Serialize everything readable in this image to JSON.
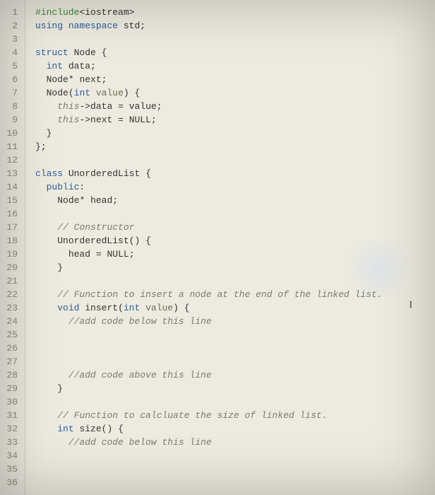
{
  "cursor_glyph": "I",
  "line_numbers": [
    "1",
    "2",
    "3",
    "4",
    "5",
    "6",
    "7",
    "8",
    "9",
    "10",
    "11",
    "12",
    "13",
    "14",
    "15",
    "16",
    "17",
    "18",
    "19",
    "20",
    "21",
    "22",
    "23",
    "24",
    "25",
    "26",
    "27",
    "28",
    "29",
    "30",
    "31",
    "32",
    "33",
    "34",
    "35",
    "36"
  ],
  "lines": [
    {
      "tokens": [
        {
          "cls": "tok-pp",
          "t": "#include"
        },
        {
          "cls": "tok-op",
          "t": "<"
        },
        {
          "cls": "tok-ident",
          "t": "iostream"
        },
        {
          "cls": "tok-op",
          "t": ">"
        }
      ]
    },
    {
      "tokens": [
        {
          "cls": "tok-kw",
          "t": "using"
        },
        {
          "cls": "",
          "t": " "
        },
        {
          "cls": "tok-kw",
          "t": "namespace"
        },
        {
          "cls": "",
          "t": " "
        },
        {
          "cls": "tok-ident",
          "t": "std"
        },
        {
          "cls": "tok-op",
          "t": ";"
        }
      ]
    },
    {
      "tokens": []
    },
    {
      "tokens": [
        {
          "cls": "tok-kw",
          "t": "struct"
        },
        {
          "cls": "",
          "t": " "
        },
        {
          "cls": "tok-ident",
          "t": "Node"
        },
        {
          "cls": "",
          "t": " "
        },
        {
          "cls": "tok-op",
          "t": "{"
        }
      ]
    },
    {
      "tokens": [
        {
          "cls": "",
          "t": "  "
        },
        {
          "cls": "tok-type",
          "t": "int"
        },
        {
          "cls": "",
          "t": " "
        },
        {
          "cls": "tok-ident",
          "t": "data"
        },
        {
          "cls": "tok-op",
          "t": ";"
        }
      ]
    },
    {
      "tokens": [
        {
          "cls": "",
          "t": "  "
        },
        {
          "cls": "tok-ident",
          "t": "Node"
        },
        {
          "cls": "tok-op",
          "t": "*"
        },
        {
          "cls": "",
          "t": " "
        },
        {
          "cls": "tok-ident",
          "t": "next"
        },
        {
          "cls": "tok-op",
          "t": ";"
        }
      ]
    },
    {
      "tokens": [
        {
          "cls": "",
          "t": "  "
        },
        {
          "cls": "tok-ident",
          "t": "Node"
        },
        {
          "cls": "tok-op",
          "t": "("
        },
        {
          "cls": "tok-type",
          "t": "int"
        },
        {
          "cls": "",
          "t": " "
        },
        {
          "cls": "tok-param",
          "t": "value"
        },
        {
          "cls": "tok-op",
          "t": ")"
        },
        {
          "cls": "",
          "t": " "
        },
        {
          "cls": "tok-op",
          "t": "{"
        }
      ]
    },
    {
      "tokens": [
        {
          "cls": "",
          "t": "    "
        },
        {
          "cls": "tok-this",
          "t": "this"
        },
        {
          "cls": "tok-op",
          "t": "->"
        },
        {
          "cls": "tok-ident",
          "t": "data"
        },
        {
          "cls": "",
          "t": " "
        },
        {
          "cls": "tok-op",
          "t": "="
        },
        {
          "cls": "",
          "t": " "
        },
        {
          "cls": "tok-ident",
          "t": "value"
        },
        {
          "cls": "tok-op",
          "t": ";"
        }
      ]
    },
    {
      "tokens": [
        {
          "cls": "",
          "t": "    "
        },
        {
          "cls": "tok-this",
          "t": "this"
        },
        {
          "cls": "tok-op",
          "t": "->"
        },
        {
          "cls": "tok-ident",
          "t": "next"
        },
        {
          "cls": "",
          "t": " "
        },
        {
          "cls": "tok-op",
          "t": "="
        },
        {
          "cls": "",
          "t": " "
        },
        {
          "cls": "tok-ident",
          "t": "NULL"
        },
        {
          "cls": "tok-op",
          "t": ";"
        }
      ]
    },
    {
      "tokens": [
        {
          "cls": "",
          "t": "  "
        },
        {
          "cls": "tok-op",
          "t": "}"
        }
      ]
    },
    {
      "tokens": [
        {
          "cls": "tok-op",
          "t": "};"
        }
      ]
    },
    {
      "tokens": []
    },
    {
      "tokens": [
        {
          "cls": "tok-kw",
          "t": "class"
        },
        {
          "cls": "",
          "t": " "
        },
        {
          "cls": "tok-ident",
          "t": "UnorderedList"
        },
        {
          "cls": "",
          "t": " "
        },
        {
          "cls": "tok-op",
          "t": "{"
        }
      ]
    },
    {
      "tokens": [
        {
          "cls": "",
          "t": "  "
        },
        {
          "cls": "tok-kw",
          "t": "public"
        },
        {
          "cls": "tok-op",
          "t": ":"
        }
      ]
    },
    {
      "tokens": [
        {
          "cls": "",
          "t": "    "
        },
        {
          "cls": "tok-ident",
          "t": "Node"
        },
        {
          "cls": "tok-op",
          "t": "*"
        },
        {
          "cls": "",
          "t": " "
        },
        {
          "cls": "tok-ident",
          "t": "head"
        },
        {
          "cls": "tok-op",
          "t": ";"
        }
      ]
    },
    {
      "tokens": []
    },
    {
      "tokens": [
        {
          "cls": "",
          "t": "    "
        },
        {
          "cls": "tok-comment",
          "t": "// Constructor"
        }
      ]
    },
    {
      "tokens": [
        {
          "cls": "",
          "t": "    "
        },
        {
          "cls": "tok-ident",
          "t": "UnorderedList"
        },
        {
          "cls": "tok-op",
          "t": "()"
        },
        {
          "cls": "",
          "t": " "
        },
        {
          "cls": "tok-op",
          "t": "{"
        }
      ]
    },
    {
      "tokens": [
        {
          "cls": "",
          "t": "      "
        },
        {
          "cls": "tok-ident",
          "t": "head"
        },
        {
          "cls": "",
          "t": " "
        },
        {
          "cls": "tok-op",
          "t": "="
        },
        {
          "cls": "",
          "t": " "
        },
        {
          "cls": "tok-ident",
          "t": "NULL"
        },
        {
          "cls": "tok-op",
          "t": ";"
        }
      ]
    },
    {
      "tokens": [
        {
          "cls": "",
          "t": "    "
        },
        {
          "cls": "tok-op",
          "t": "}"
        }
      ]
    },
    {
      "tokens": []
    },
    {
      "tokens": [
        {
          "cls": "",
          "t": "    "
        },
        {
          "cls": "tok-comment",
          "t": "// Function to insert a node at the end of the linked list."
        }
      ]
    },
    {
      "tokens": [
        {
          "cls": "",
          "t": "    "
        },
        {
          "cls": "tok-type",
          "t": "void"
        },
        {
          "cls": "",
          "t": " "
        },
        {
          "cls": "tok-ident",
          "t": "insert"
        },
        {
          "cls": "tok-op",
          "t": "("
        },
        {
          "cls": "tok-type",
          "t": "int"
        },
        {
          "cls": "",
          "t": " "
        },
        {
          "cls": "tok-param",
          "t": "value"
        },
        {
          "cls": "tok-op",
          "t": ")"
        },
        {
          "cls": "",
          "t": " "
        },
        {
          "cls": "tok-op",
          "t": "{"
        }
      ]
    },
    {
      "tokens": [
        {
          "cls": "",
          "t": "      "
        },
        {
          "cls": "tok-comment",
          "t": "//add code below this line"
        }
      ]
    },
    {
      "tokens": []
    },
    {
      "tokens": []
    },
    {
      "tokens": []
    },
    {
      "tokens": [
        {
          "cls": "",
          "t": "      "
        },
        {
          "cls": "tok-comment",
          "t": "//add code above this line"
        }
      ]
    },
    {
      "tokens": [
        {
          "cls": "",
          "t": "    "
        },
        {
          "cls": "tok-op",
          "t": "}"
        }
      ]
    },
    {
      "tokens": []
    },
    {
      "tokens": [
        {
          "cls": "",
          "t": "    "
        },
        {
          "cls": "tok-comment",
          "t": "// Function to calcluate the size of linked list."
        }
      ]
    },
    {
      "tokens": [
        {
          "cls": "",
          "t": "    "
        },
        {
          "cls": "tok-type",
          "t": "int"
        },
        {
          "cls": "",
          "t": " "
        },
        {
          "cls": "tok-ident",
          "t": "size"
        },
        {
          "cls": "tok-op",
          "t": "()"
        },
        {
          "cls": "",
          "t": " "
        },
        {
          "cls": "tok-op",
          "t": "{"
        }
      ]
    },
    {
      "tokens": [
        {
          "cls": "",
          "t": "      "
        },
        {
          "cls": "tok-comment",
          "t": "//add code below this line"
        }
      ]
    },
    {
      "tokens": []
    },
    {
      "tokens": []
    },
    {
      "tokens": []
    }
  ]
}
